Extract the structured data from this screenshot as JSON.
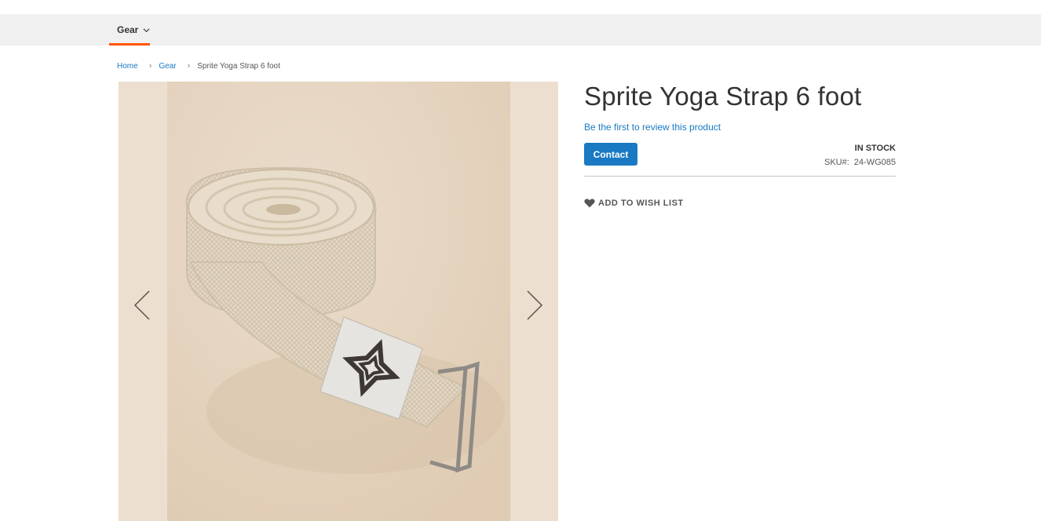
{
  "nav": {
    "items": [
      {
        "label": "Gear"
      }
    ]
  },
  "breadcrumb": {
    "home": "Home",
    "category": "Gear",
    "current": "Sprite Yoga Strap 6 foot",
    "separator": "›"
  },
  "gallery": {
    "image_alt": "Sprite Yoga Strap 6 foot"
  },
  "product": {
    "title": "Sprite Yoga Strap 6 foot",
    "review_link": "Be the first to review this product",
    "contact_label": "Contact",
    "stock_status": "In stock",
    "sku_label": "SKU#:",
    "sku_value": "24-WG085",
    "wishlist_label": "ADD TO WISH LIST"
  },
  "colors": {
    "accent": "#1979c3",
    "nav_active": "#ff5501"
  }
}
